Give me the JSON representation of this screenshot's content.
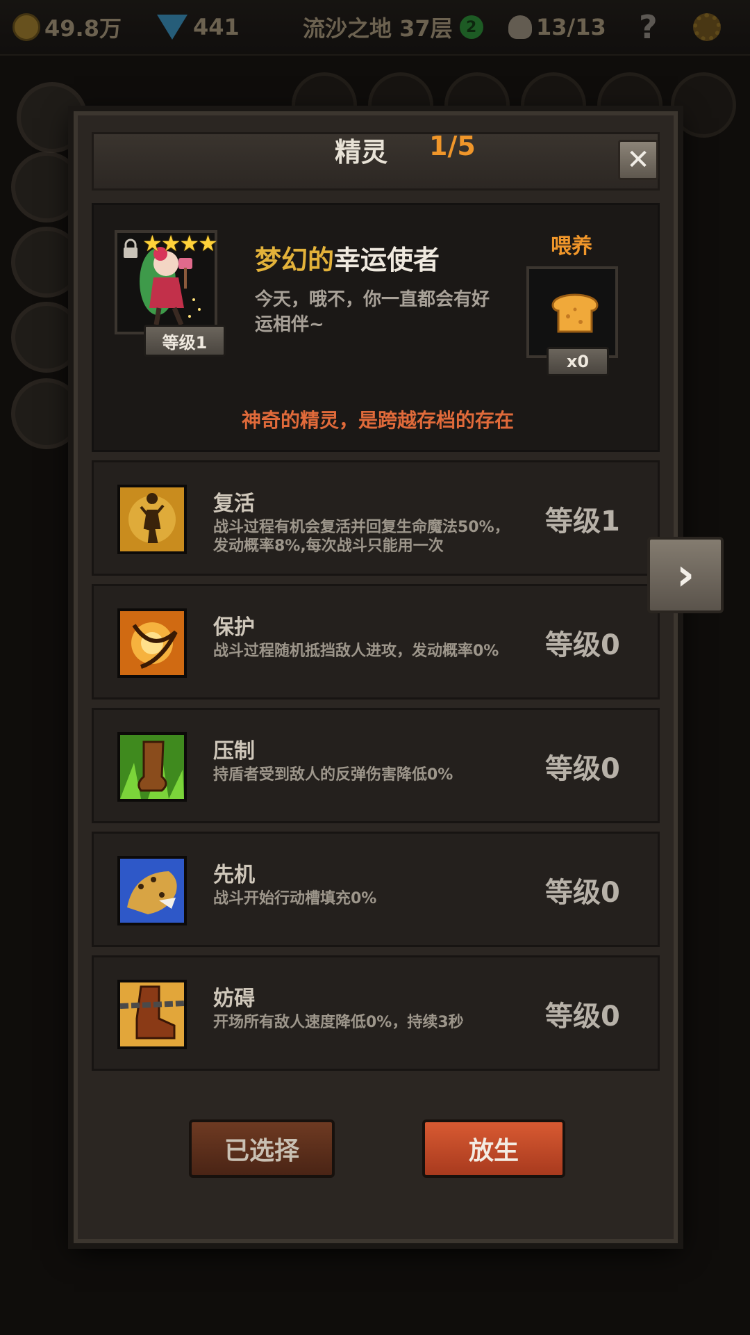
{
  "topbar": {
    "gold": "49.8万",
    "gems": "441",
    "stage": "流沙之地 37层",
    "stage_badge": "2",
    "kills": "13/13",
    "help": "?"
  },
  "dialog": {
    "title": "精灵",
    "count": "1/5",
    "close": "✕"
  },
  "spirit": {
    "stars": "★★★★",
    "level": "等级1",
    "name_prefix": "梦幻的",
    "name_core": "幸运使者",
    "description": "今天，哦不，你一直都会有好运相伴~",
    "feed_label": "喂养",
    "feed_count": "x0",
    "note": "神奇的精灵，是跨越存档的存在"
  },
  "skills": [
    {
      "icon": "revive-icon",
      "name": "复活",
      "desc": "战斗过程有机会复活并回复生命魔法50%，发动概率8%,每次战斗只能用一次",
      "level": "等级1"
    },
    {
      "icon": "protect-icon",
      "name": "保护",
      "desc": "战斗过程随机抵挡敌人进攻，发动概率0%",
      "level": "等级0"
    },
    {
      "icon": "suppress-icon",
      "name": "压制",
      "desc": "持盾者受到敌人的反弹伤害降低0%",
      "level": "等级0"
    },
    {
      "icon": "initiative-icon",
      "name": "先机",
      "desc": "战斗开始行动槽填充0%",
      "level": "等级0"
    },
    {
      "icon": "hinder-icon",
      "name": "妨碍",
      "desc": "开场所有敌人速度降低0%，持续3秒",
      "level": "等级0"
    }
  ],
  "buttons": {
    "selected": "已选择",
    "release": "放生",
    "next": "›"
  },
  "colors": {
    "accent_orange": "#f0962a",
    "note_red": "#e06a3a",
    "gold_name": "#e3b23a"
  }
}
